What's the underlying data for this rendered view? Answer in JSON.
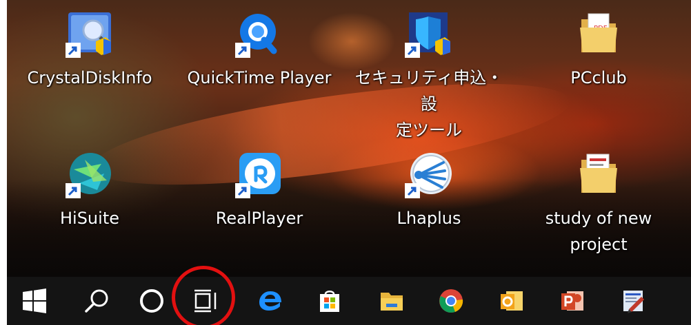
{
  "desktop": {
    "icons": [
      {
        "label": "CrystalDiskInfo",
        "icon": "crystaldiskinfo-icon"
      },
      {
        "label": "QuickTime Player",
        "icon": "quicktime-icon"
      },
      {
        "label": "セキュリティ申込・設定ツール",
        "label_line1": "セキュリティ申込・設",
        "label_line2": "定ツール",
        "icon": "security-tool-icon"
      },
      {
        "label": "PCclub",
        "icon": "folder-icon"
      },
      {
        "label": "HiSuite",
        "icon": "hisuite-icon"
      },
      {
        "label": "RealPlayer",
        "icon": "realplayer-icon"
      },
      {
        "label": "Lhaplus",
        "icon": "lhaplus-icon"
      },
      {
        "label": "study of new project",
        "label_line1": "study of new",
        "label_line2": "project",
        "icon": "folder-icon"
      }
    ]
  },
  "taskbar": {
    "items": [
      {
        "name": "start-button",
        "icon": "windows-logo-icon"
      },
      {
        "name": "search-button",
        "icon": "search-icon"
      },
      {
        "name": "cortana-button",
        "icon": "cortana-circle-icon"
      },
      {
        "name": "task-view-button",
        "icon": "task-view-icon",
        "highlighted": true
      },
      {
        "name": "edge-button",
        "icon": "edge-icon"
      },
      {
        "name": "store-button",
        "icon": "store-icon"
      },
      {
        "name": "file-explorer-button",
        "icon": "folder-icon"
      },
      {
        "name": "chrome-button",
        "icon": "chrome-icon"
      },
      {
        "name": "outlook-button",
        "icon": "outlook-icon"
      },
      {
        "name": "powerpoint-button",
        "icon": "powerpoint-icon"
      },
      {
        "name": "app-button",
        "icon": "document-pen-icon"
      }
    ]
  },
  "colors": {
    "taskbar": "#141414",
    "highlight": "#e31010"
  }
}
